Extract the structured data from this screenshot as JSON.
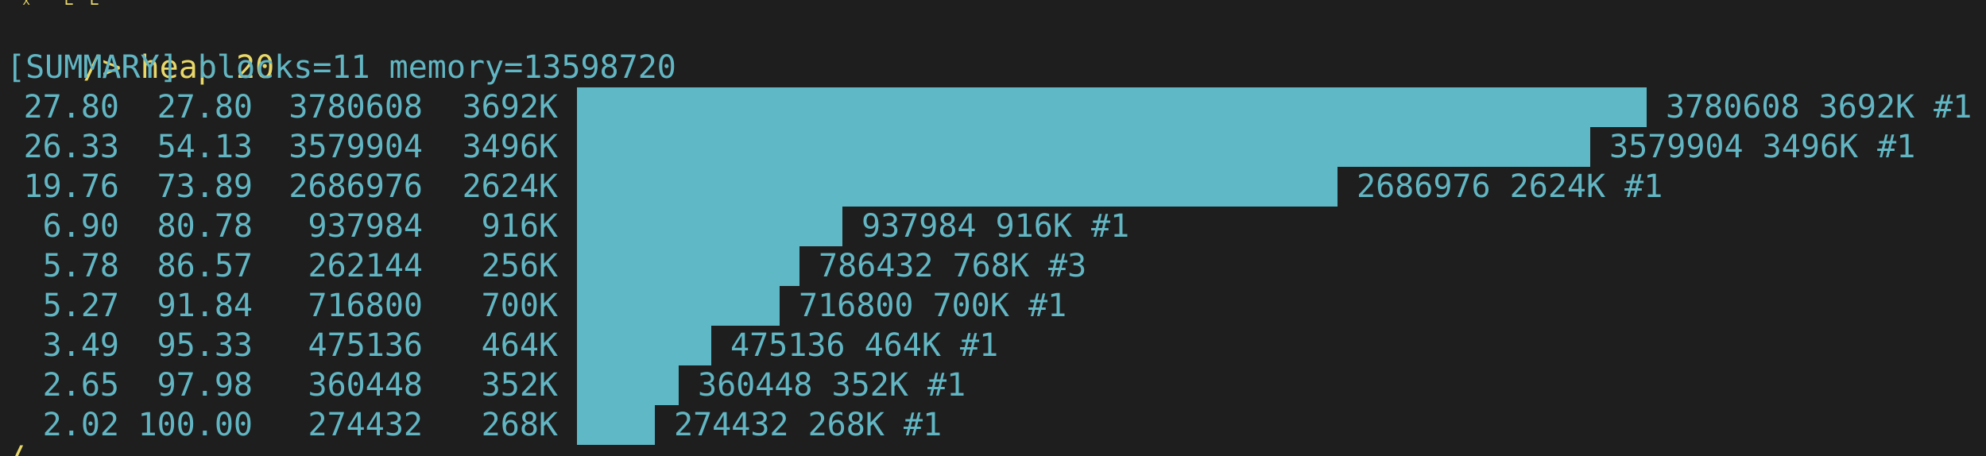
{
  "terminal": {
    "top_cut_text": "␂ ␤␤",
    "prompt": "/> ",
    "command": "heap 20",
    "summary": "[SUMMARY] blocks=11 memory=13598720",
    "bottom_cut_text": "/",
    "colors": {
      "background": "#1e1e1e",
      "text": "#62b6c3",
      "prompt": "#e8d86a",
      "bar": "#5fb8c6"
    }
  },
  "rows": [
    {
      "pct": "27.80",
      "cum": "27.80",
      "bytes": "3780608",
      "kb": "3692K",
      "label": "3780608 3692K #1",
      "fraction": 1.0
    },
    {
      "pct": "26.33",
      "cum": "54.13",
      "bytes": "3579904",
      "kb": "3496K",
      "label": "3579904 3496K #1",
      "fraction": 0.9469
    },
    {
      "pct": "19.76",
      "cum": "73.89",
      "bytes": "2686976",
      "kb": "2624K",
      "label": "2686976 2624K #1",
      "fraction": 0.7107
    },
    {
      "pct": "6.90",
      "cum": "80.78",
      "bytes": "937984",
      "kb": "916K",
      "label": "937984 916K #1",
      "fraction": 0.2481
    },
    {
      "pct": "5.78",
      "cum": "86.57",
      "bytes": "262144",
      "kb": "256K",
      "label": "786432 768K #3",
      "fraction": 0.208
    },
    {
      "pct": "5.27",
      "cum": "91.84",
      "bytes": "716800",
      "kb": "700K",
      "label": "716800 700K #1",
      "fraction": 0.1896
    },
    {
      "pct": "3.49",
      "cum": "95.33",
      "bytes": "475136",
      "kb": "464K",
      "label": "475136 464K #1",
      "fraction": 0.1257
    },
    {
      "pct": "2.65",
      "cum": "97.98",
      "bytes": "360448",
      "kb": "352K",
      "label": "360448 352K #1",
      "fraction": 0.0953
    },
    {
      "pct": "2.02",
      "cum": "100.00",
      "bytes": "274432",
      "kb": "268K",
      "label": "274432 268K #1",
      "fraction": 0.0726
    }
  ]
}
